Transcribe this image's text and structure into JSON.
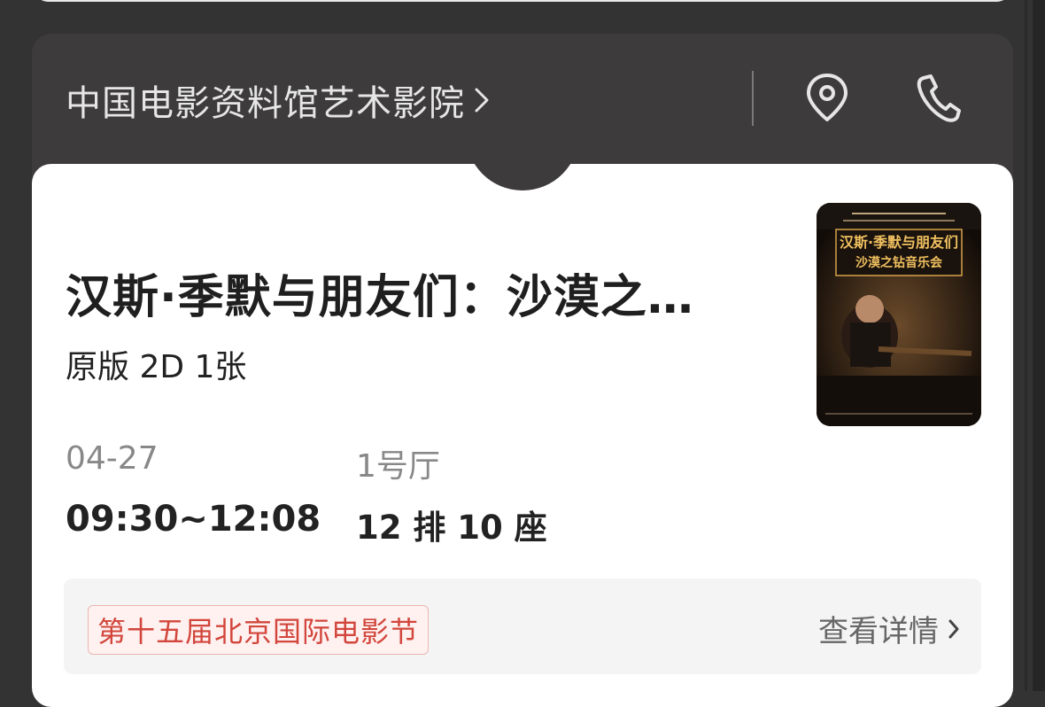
{
  "cinema": {
    "name": "中国电影资料馆艺术影院"
  },
  "icons": {
    "location": "location-pin-icon",
    "phone": "phone-icon",
    "chevron": "chevron-right-icon"
  },
  "movie": {
    "title": "汉斯·季默与朋友们：沙漠之…",
    "format": "原版 2D 1张",
    "poster_title_line1": "汉斯·季默与朋友们",
    "poster_title_line2": "沙漠之钻音乐会"
  },
  "showtime": {
    "date": "04-27",
    "time": "09:30~12:08",
    "hall": "1号厅",
    "seat": "12 排 10 座"
  },
  "festival": {
    "tag": "第十五届北京国际电影节",
    "details_label": "查看详情"
  },
  "colors": {
    "accent_red": "#d2463c",
    "header_bg": "#3d3b3b"
  }
}
